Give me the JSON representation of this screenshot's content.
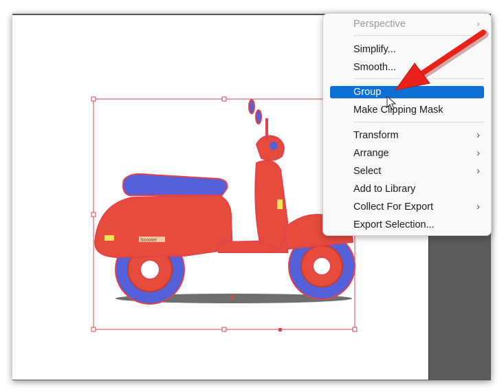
{
  "context_menu": {
    "items": [
      {
        "label": "Perspective",
        "disabled": true,
        "submenu": true
      },
      {
        "label": "Simplify..."
      },
      {
        "label": "Smooth..."
      },
      {
        "label": "Group",
        "highlighted": true
      },
      {
        "label": "Make Clipping Mask"
      },
      {
        "label": "Transform",
        "submenu": true
      },
      {
        "label": "Arrange",
        "submenu": true
      },
      {
        "label": "Select",
        "submenu": true
      },
      {
        "label": "Add to Library"
      },
      {
        "label": "Collect For Export",
        "submenu": true
      },
      {
        "label": "Export Selection..."
      }
    ],
    "chevron_glyph": "›"
  },
  "colors": {
    "highlight": "#0b6fd6",
    "annotation_arrow": "#e8211b",
    "selection": "#e2424a",
    "pasteboard": "#5b5b5b"
  },
  "artwork": {
    "name": "scooter",
    "badge_text": "Scooter"
  }
}
